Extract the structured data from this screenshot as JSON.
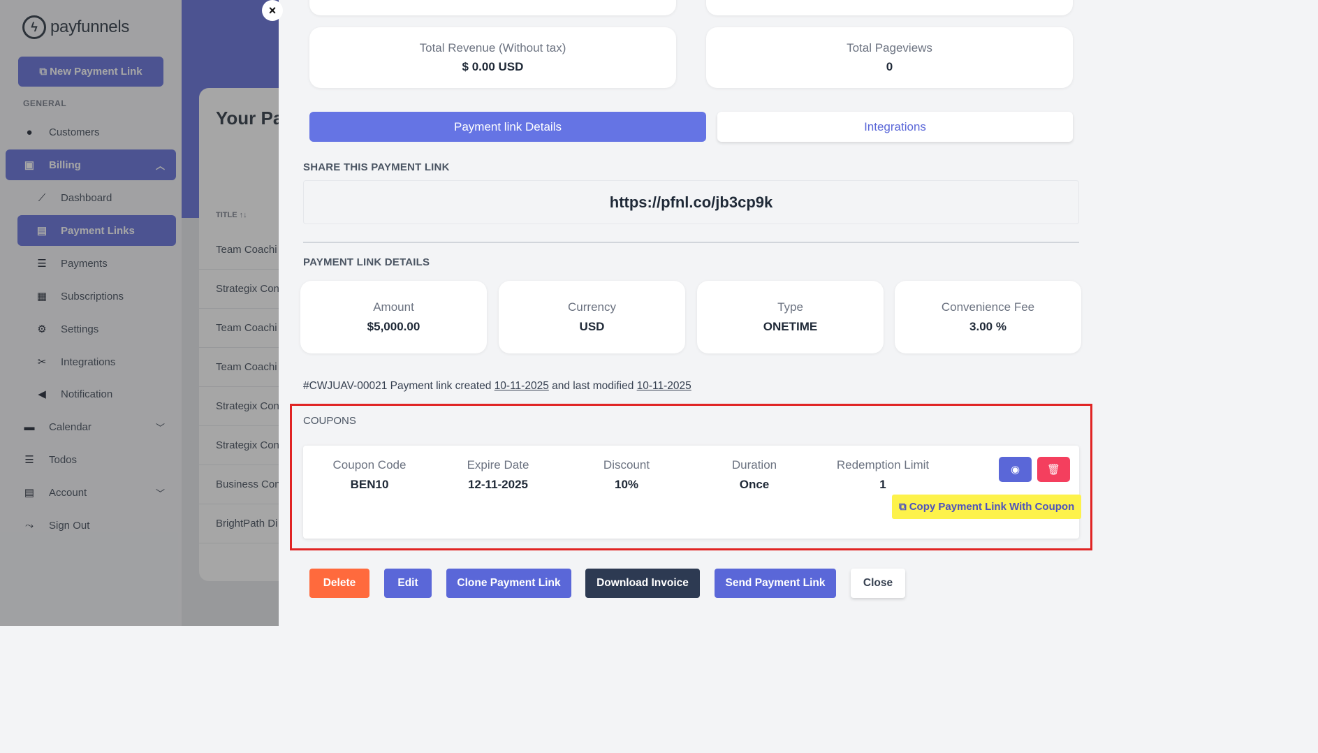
{
  "sidebar": {
    "logo_text": "payfunnels",
    "new_link_button": "New Payment Link",
    "section_label": "GENERAL",
    "items": {
      "customers": "Customers",
      "billing": "Billing",
      "dashboard": "Dashboard",
      "payment_links": "Payment Links",
      "payments": "Payments",
      "subscriptions": "Subscriptions",
      "settings": "Settings",
      "integrations": "Integrations",
      "notification": "Notification",
      "calendar": "Calendar",
      "todos": "Todos",
      "account": "Account",
      "sign_out": "Sign Out"
    }
  },
  "background_page": {
    "title": "Your Pay",
    "column_header": "TITLE ↑↓",
    "rows": [
      "Team Coachi",
      "Strategix Con",
      "Team Coachi",
      "Team Coachi",
      "Strategix Con",
      "Strategix Con",
      "Business Con",
      "BrightPath Di"
    ]
  },
  "modal": {
    "close_icon": "×",
    "stats": {
      "revenue_label": "Total Revenue (Without tax)",
      "revenue_value": "$ 0.00 USD",
      "pageviews_label": "Total Pageviews",
      "pageviews_value": "0"
    },
    "tabs": {
      "details": "Payment link Details",
      "integrations": "Integrations"
    },
    "share_heading": "SHARE THIS PAYMENT LINK",
    "share_url": "https://pfnl.co/jb3cp9k",
    "details_heading": "PAYMENT LINK DETAILS",
    "details": {
      "amount_label": "Amount",
      "amount_value": "$5,000.00",
      "currency_label": "Currency",
      "currency_value": "USD",
      "type_label": "Type",
      "type_value": "ONETIME",
      "fee_label": "Convenience Fee",
      "fee_value": "3.00 %"
    },
    "meta": {
      "prefix": "#CWJUAV-00021 Payment link created",
      "created": "10-11-2025",
      "middle": "and last modified",
      "modified": "10-11-2025"
    },
    "coupons": {
      "heading": "COUPONS",
      "code_label": "Coupon Code",
      "code_value": "BEN10",
      "expire_label": "Expire Date",
      "expire_value": "12-11-2025",
      "discount_label": "Discount",
      "discount_value": "10%",
      "duration_label": "Duration",
      "duration_value": "Once",
      "limit_label": "Redemption Limit",
      "limit_value": "1",
      "copy_link": "Copy Payment Link With Coupon"
    },
    "actions": {
      "delete": "Delete",
      "edit": "Edit",
      "clone": "Clone Payment Link",
      "invoice": "Download Invoice",
      "send": "Send Payment Link",
      "close": "Close"
    }
  },
  "colors": {
    "primary": "#5a67d8",
    "danger": "#f43f5e",
    "delete": "#ff6a3d",
    "dark": "#2d3a52",
    "highlight": "#fdf24b",
    "annotation": "#e02424"
  }
}
